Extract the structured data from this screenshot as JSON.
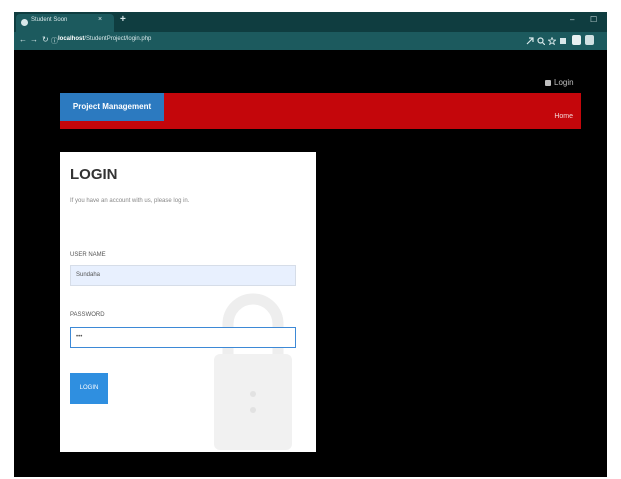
{
  "browser": {
    "tab_title": "Student Soon",
    "close_glyph": "×",
    "new_tab_glyph": "+",
    "minimize_glyph": "–",
    "restore_glyph": "☐",
    "url_host": "localhost",
    "url_path": "/StudentProject/login.php",
    "back_glyph": "←",
    "forward_glyph": "→",
    "reload_glyph": "↻",
    "info_glyph": "ⓘ"
  },
  "page": {
    "top_login_label": "Login",
    "brand_label": "Project Management",
    "home_label": "Home"
  },
  "login_form": {
    "title": "LOGIN",
    "subtitle": "If you have an account with us, please log in.",
    "username_label": "USER NAME",
    "username_value": "Sundaha",
    "password_label": "PASSWORD",
    "password_value": "•••",
    "submit_label": "LOGIN"
  },
  "colors": {
    "header_red": "#c4060b",
    "brand_blue": "#2c7ac0",
    "button_blue": "#2f8fe0",
    "browser_chrome": "#1c5a5e"
  },
  "icons": [
    "browser-favicon",
    "back-arrow-icon",
    "forward-arrow-icon",
    "reload-icon",
    "info-icon",
    "share-icon",
    "search-icon",
    "star-icon",
    "extensions-icon",
    "profile-icon",
    "user-icon",
    "lock-illustration"
  ]
}
